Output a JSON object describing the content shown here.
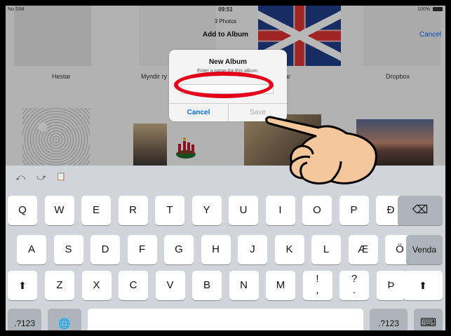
{
  "status": {
    "carrier": "No SIM",
    "time": "09:51",
    "battery": "100%"
  },
  "header": {
    "subtitle": "3 Photos",
    "title": "Add to Album",
    "cancel": "Cancel"
  },
  "albums": [
    {
      "label": "Hestar"
    },
    {
      "label": "Myndir ry"
    },
    {
      "label": "ar"
    },
    {
      "label": "Dropbox"
    }
  ],
  "dialog": {
    "title": "New Album",
    "message": "Enter a name for this album.",
    "input_value": "",
    "cancel": "Cancel",
    "save": "Save"
  },
  "keyboard": {
    "tools": {
      "undo": "⤺",
      "redo": "⤻",
      "paste": "📋"
    },
    "row1": [
      "Q",
      "W",
      "E",
      "R",
      "T",
      "Y",
      "U",
      "I",
      "O",
      "P",
      "Ð"
    ],
    "row2": [
      "A",
      "S",
      "D",
      "F",
      "G",
      "H",
      "J",
      "K",
      "L",
      "Æ",
      "Ö"
    ],
    "row3": [
      "Z",
      "X",
      "C",
      "V",
      "B",
      "N",
      "M",
      "!\n,",
      "?\n.",
      "Þ"
    ],
    "backspace": "⌫",
    "return_label": "Venda",
    "shift": "⬆",
    "numbers_left": ".?123",
    "numbers_right": ".?123",
    "globe": "🌐",
    "space": "",
    "dismiss": "⌨"
  },
  "colors": {
    "accent": "#0a6cff",
    "annotation": "#e3001b"
  }
}
